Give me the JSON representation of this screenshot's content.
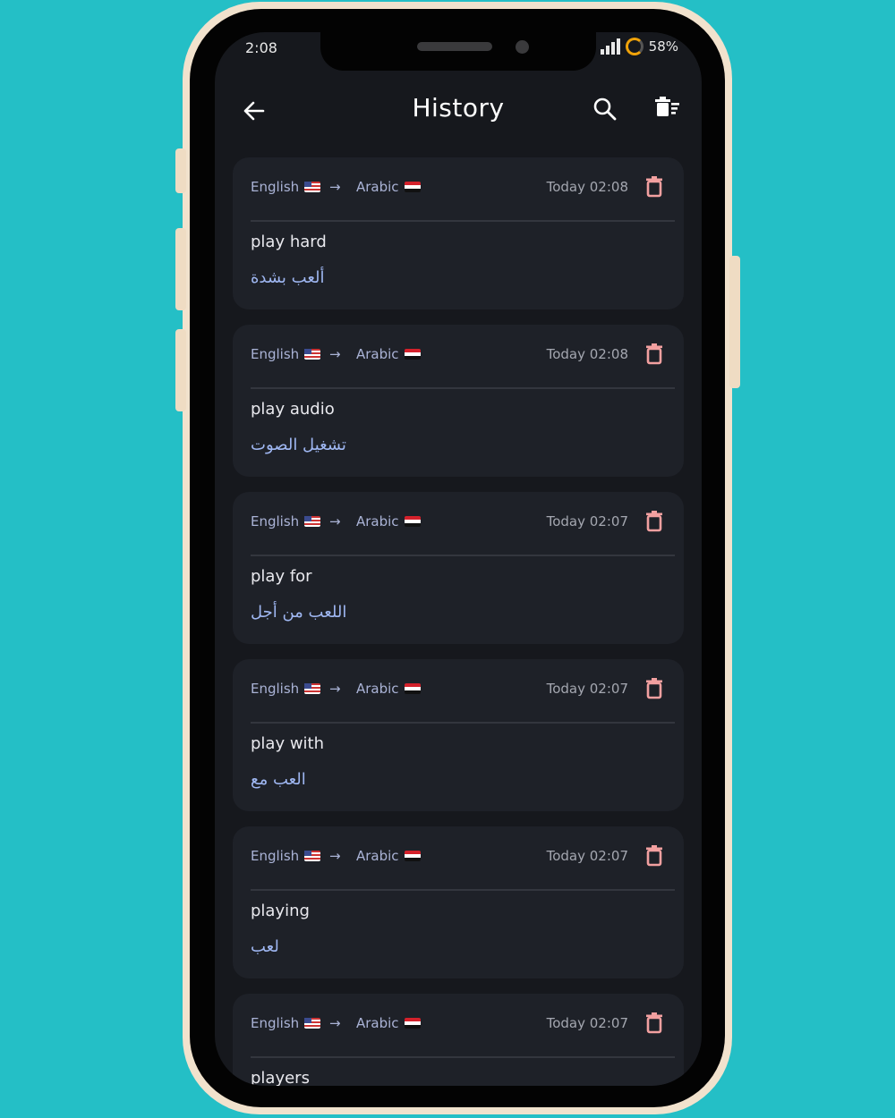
{
  "status_bar": {
    "time": "2:08",
    "battery": "58%"
  },
  "header": {
    "title": "History"
  },
  "history": [
    {
      "source_lang": "English",
      "target_lang": "Arabic",
      "arrow": "→",
      "date": "Today 02:08",
      "source_text": "play hard",
      "translation": "ألعب بشدة"
    },
    {
      "source_lang": "English",
      "target_lang": "Arabic",
      "arrow": "→",
      "date": "Today 02:08",
      "source_text": "play audio",
      "translation": "تشغيل الصوت"
    },
    {
      "source_lang": "English",
      "target_lang": "Arabic",
      "arrow": "→",
      "date": "Today 02:07",
      "source_text": "play for",
      "translation": "اللعب من أجل"
    },
    {
      "source_lang": "English",
      "target_lang": "Arabic",
      "arrow": "→",
      "date": "Today 02:07",
      "source_text": "play with",
      "translation": "العب مع"
    },
    {
      "source_lang": "English",
      "target_lang": "Arabic",
      "arrow": "→",
      "date": "Today 02:07",
      "source_text": "playing",
      "translation": "لعب"
    },
    {
      "source_lang": "English",
      "target_lang": "Arabic",
      "arrow": "→",
      "date": "Today 02:07",
      "source_text": "players",
      "translation": ""
    }
  ],
  "colors": {
    "background": "#24bfc6",
    "card": "#1e2128",
    "delete_icon": "#f2a0a0",
    "accent_text": "#9fb7f2"
  },
  "icons": {
    "back": "arrow-left-icon",
    "search": "search-icon",
    "clear_all": "delete-sweep-icon",
    "delete": "trash-icon"
  }
}
